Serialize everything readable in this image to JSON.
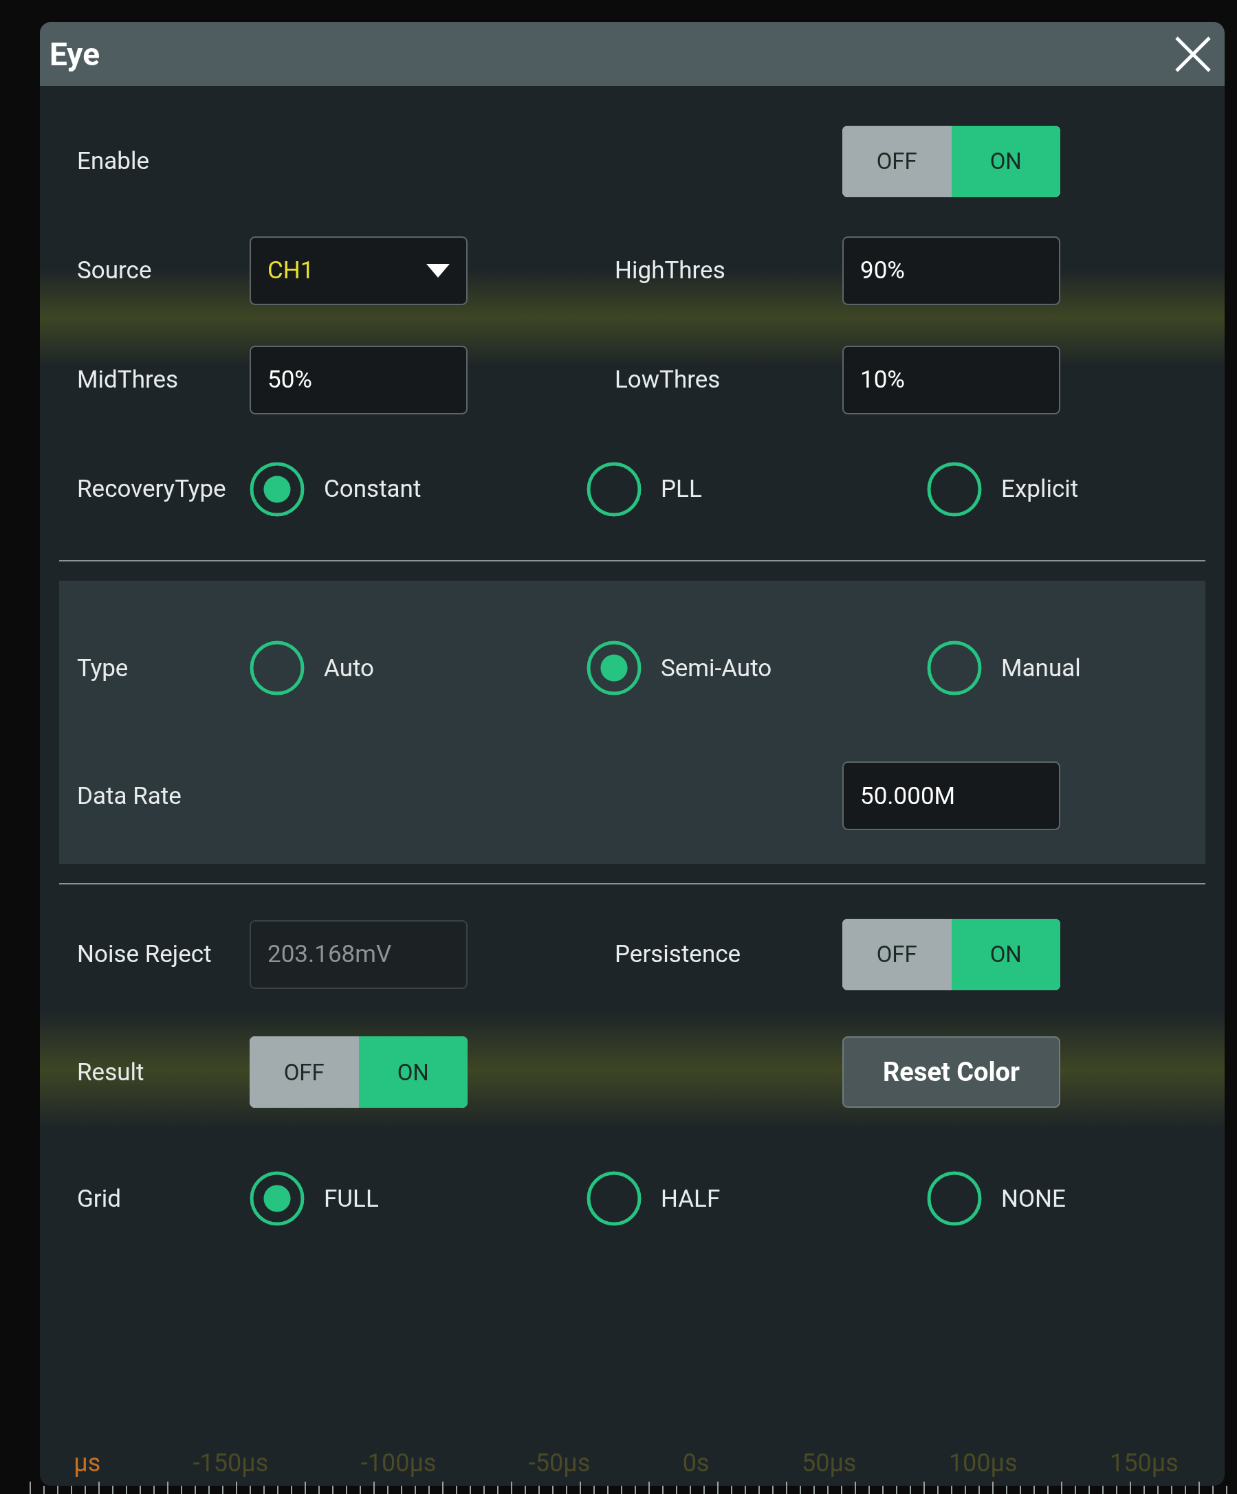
{
  "dialog": {
    "title": "Eye",
    "sections": [
      {
        "kind": "plain",
        "rows": [
          {
            "kind": "fields",
            "cells": [
              {
                "kind": "label",
                "text": "Enable"
              },
              {
                "kind": "toggle",
                "off": "OFF",
                "on": "ON",
                "on_state": true
              }
            ]
          },
          {
            "kind": "fields",
            "cells": [
              {
                "kind": "label",
                "text": "Source"
              },
              {
                "kind": "dropdown",
                "value": "CH1"
              },
              {
                "kind": "label",
                "text": "HighThres"
              },
              {
                "kind": "input",
                "value": "90%",
                "disabled": false
              }
            ]
          },
          {
            "kind": "fields",
            "cells": [
              {
                "kind": "label",
                "text": "MidThres"
              },
              {
                "kind": "input",
                "value": "50%",
                "disabled": false
              },
              {
                "kind": "label",
                "text": "LowThres"
              },
              {
                "kind": "input",
                "value": "10%",
                "disabled": false
              }
            ]
          },
          {
            "kind": "radio",
            "label": "RecoveryType",
            "options": [
              {
                "label": "Constant",
                "selected": true
              },
              {
                "label": "PLL",
                "selected": false
              },
              {
                "label": "Explicit",
                "selected": false
              }
            ]
          }
        ]
      },
      {
        "kind": "panel",
        "rows": [
          {
            "kind": "radio",
            "label": "Type",
            "options": [
              {
                "label": "Auto",
                "selected": false
              },
              {
                "label": "Semi-Auto",
                "selected": true
              },
              {
                "label": "Manual",
                "selected": false
              }
            ]
          },
          {
            "kind": "fields",
            "cells": [
              {
                "kind": "label",
                "text": "Data Rate"
              },
              {
                "kind": "input",
                "value": "50.000M",
                "disabled": false
              }
            ]
          }
        ]
      },
      {
        "kind": "plain",
        "rows": [
          {
            "kind": "fields",
            "cells": [
              {
                "kind": "label",
                "text": "Noise Reject"
              },
              {
                "kind": "input",
                "value": "203.168mV",
                "disabled": true
              },
              {
                "kind": "label",
                "text": "Persistence"
              },
              {
                "kind": "toggle",
                "off": "OFF",
                "on": "ON",
                "on_state": true
              }
            ]
          },
          {
            "kind": "fields",
            "cells": [
              {
                "kind": "label",
                "text": "Result"
              },
              {
                "kind": "toggle",
                "off": "OFF",
                "on": "ON",
                "on_state": true
              },
              {
                "kind": "button",
                "text": "Reset Color"
              }
            ]
          },
          {
            "kind": "radio",
            "label": "Grid",
            "options": [
              {
                "label": "FULL",
                "selected": true
              },
              {
                "label": "HALF",
                "selected": false
              },
              {
                "label": "NONE",
                "selected": false
              }
            ]
          }
        ]
      }
    ]
  },
  "time_axis": {
    "labels": [
      {
        "text": "μs",
        "color": "#c8701e"
      },
      {
        "text": "-150μs",
        "color": "#4a4a26"
      },
      {
        "text": "-100μs",
        "color": "#4a4a26"
      },
      {
        "text": "-50μs",
        "color": "#4a4a26"
      },
      {
        "text": "0s",
        "color": "#4a4a26"
      },
      {
        "text": "50μs",
        "color": "#4a4a26"
      },
      {
        "text": "100μs",
        "color": "#4a4a26"
      },
      {
        "text": "150μs",
        "color": "#4a4a26"
      }
    ]
  }
}
